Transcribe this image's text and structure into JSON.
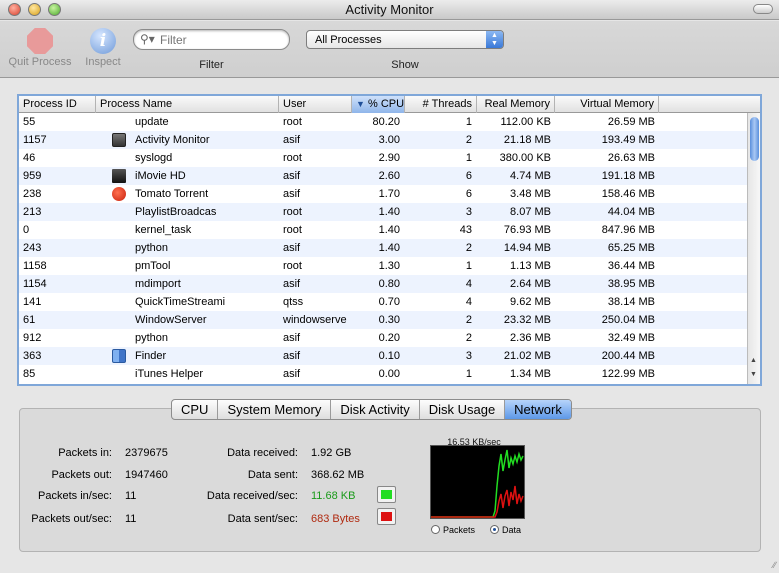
{
  "window": {
    "title": "Activity Monitor"
  },
  "toolbar": {
    "quit_label": "Quit Process",
    "inspect_label": "Inspect",
    "filter_placeholder": "Filter",
    "filter_label": "Filter",
    "show_value": "All Processes",
    "show_label": "Show"
  },
  "table": {
    "columns": [
      "Process ID",
      "Process Name",
      "User",
      "% CPU",
      "# Threads",
      "Real Memory",
      "Virtual Memory"
    ],
    "sort_column": "% CPU",
    "sort_direction": "descending",
    "rows": [
      {
        "pid": "55",
        "name": "update",
        "user": "root",
        "cpu": "80.20",
        "threads": "1",
        "real": "112.00 KB",
        "virtual": "26.59 MB",
        "icon": ""
      },
      {
        "pid": "1157",
        "name": "Activity Monitor",
        "user": "asif",
        "cpu": "3.00",
        "threads": "2",
        "real": "21.18 MB",
        "virtual": "193.49 MB",
        "icon": "activity-monitor"
      },
      {
        "pid": "46",
        "name": "syslogd",
        "user": "root",
        "cpu": "2.90",
        "threads": "1",
        "real": "380.00 KB",
        "virtual": "26.63 MB",
        "icon": ""
      },
      {
        "pid": "959",
        "name": "iMovie HD",
        "user": "asif",
        "cpu": "2.60",
        "threads": "6",
        "real": "4.74 MB",
        "virtual": "191.18 MB",
        "icon": "imovie"
      },
      {
        "pid": "238",
        "name": "Tomato Torrent",
        "user": "asif",
        "cpu": "1.70",
        "threads": "6",
        "real": "3.48 MB",
        "virtual": "158.46 MB",
        "icon": "tomato"
      },
      {
        "pid": "213",
        "name": "PlaylistBroadcas",
        "user": "root",
        "cpu": "1.40",
        "threads": "3",
        "real": "8.07 MB",
        "virtual": "44.04 MB",
        "icon": ""
      },
      {
        "pid": "0",
        "name": "kernel_task",
        "user": "root",
        "cpu": "1.40",
        "threads": "43",
        "real": "76.93 MB",
        "virtual": "847.96 MB",
        "icon": ""
      },
      {
        "pid": "243",
        "name": "python",
        "user": "asif",
        "cpu": "1.40",
        "threads": "2",
        "real": "14.94 MB",
        "virtual": "65.25 MB",
        "icon": ""
      },
      {
        "pid": "1158",
        "name": "pmTool",
        "user": "root",
        "cpu": "1.30",
        "threads": "1",
        "real": "1.13 MB",
        "virtual": "36.44 MB",
        "icon": ""
      },
      {
        "pid": "1154",
        "name": "mdimport",
        "user": "asif",
        "cpu": "0.80",
        "threads": "4",
        "real": "2.64 MB",
        "virtual": "38.95 MB",
        "icon": ""
      },
      {
        "pid": "141",
        "name": "QuickTimeStreami",
        "user": "qtss",
        "cpu": "0.70",
        "threads": "4",
        "real": "9.62 MB",
        "virtual": "38.14 MB",
        "icon": ""
      },
      {
        "pid": "61",
        "name": "WindowServer",
        "user": "windowserve",
        "cpu": "0.30",
        "threads": "2",
        "real": "23.32 MB",
        "virtual": "250.04 MB",
        "icon": ""
      },
      {
        "pid": "912",
        "name": "python",
        "user": "asif",
        "cpu": "0.20",
        "threads": "2",
        "real": "2.36 MB",
        "virtual": "32.49 MB",
        "icon": ""
      },
      {
        "pid": "363",
        "name": "Finder",
        "user": "asif",
        "cpu": "0.10",
        "threads": "3",
        "real": "21.02 MB",
        "virtual": "200.44 MB",
        "icon": "finder"
      },
      {
        "pid": "85",
        "name": "iTunes Helper",
        "user": "asif",
        "cpu": "0.00",
        "threads": "1",
        "real": "1.34 MB",
        "virtual": "122.99 MB",
        "icon": ""
      }
    ]
  },
  "tabs": [
    "CPU",
    "System Memory",
    "Disk Activity",
    "Disk Usage",
    "Network"
  ],
  "active_tab": "Network",
  "network": {
    "packets_in_label": "Packets in:",
    "packets_in": "2379675",
    "packets_out_label": "Packets out:",
    "packets_out": "1947460",
    "packets_in_sec_label": "Packets in/sec:",
    "packets_in_sec": "11",
    "packets_out_sec_label": "Packets out/sec:",
    "packets_out_sec": "11",
    "data_received_label": "Data received:",
    "data_received": "1.92 GB",
    "data_sent_label": "Data sent:",
    "data_sent": "368.62 MB",
    "data_received_sec_label": "Data received/sec:",
    "data_received_sec": "11.68 KB",
    "data_sent_sec_label": "Data sent/sec:",
    "data_sent_sec": "683 Bytes",
    "graph_rate": "16.53 KB/sec",
    "radio_packets": "Packets",
    "radio_data": "Data",
    "selected_mode": "Data"
  },
  "colors": {
    "received": "#22dd22",
    "sent": "#dd1111",
    "selection_blue": "#5d98e8"
  }
}
